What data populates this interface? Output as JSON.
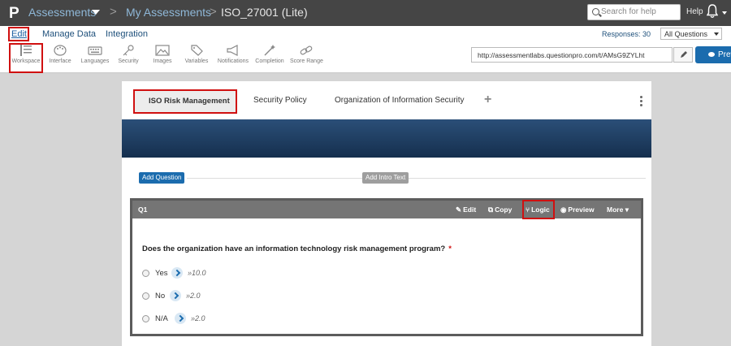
{
  "topbar": {
    "logo": "P",
    "breadcrumbs": [
      "Assessments",
      "My Assessments",
      "ISO_27001 (Lite)"
    ],
    "separator": ">",
    "search_placeholder": "Search for help",
    "help_label": "Help"
  },
  "menu": {
    "items": [
      "Edit",
      "Manage Data",
      "Integration"
    ],
    "responses_label": "Responses: 30",
    "filter_value": "All Questions"
  },
  "toolbar": {
    "tools": [
      {
        "label": "Workspace",
        "icon": "workspace-icon"
      },
      {
        "label": "Interface",
        "icon": "palette-icon"
      },
      {
        "label": "Languages",
        "icon": "keyboard-icon"
      },
      {
        "label": "Security",
        "icon": "key-icon"
      },
      {
        "label": "Images",
        "icon": "image-icon"
      },
      {
        "label": "Variables",
        "icon": "tag-icon"
      },
      {
        "label": "Notifications",
        "icon": "megaphone-icon"
      },
      {
        "label": "Completion",
        "icon": "magic-wand-icon"
      },
      {
        "label": "Score Range",
        "icon": "link-icon"
      }
    ],
    "url": "http://assessmentlabs.questionpro.com/t/AMsG9ZYLht",
    "preview_label": "Prev"
  },
  "tabs": {
    "items": [
      "ISO Risk Management",
      "Security Policy",
      "Organization of Information Security"
    ],
    "add_label": "+"
  },
  "actions": {
    "add_question": "Add Question",
    "add_intro": "Add Intro Text"
  },
  "question": {
    "number": "Q1",
    "actions": [
      "Edit",
      "Copy",
      "Logic",
      "Preview",
      "More"
    ],
    "text": "Does the organization have an information technology risk management program?",
    "required_mark": "*",
    "options": [
      {
        "label": "Yes",
        "score": "»10.0"
      },
      {
        "label": "No",
        "score": "»2.0"
      },
      {
        "label": "N/A",
        "score": "»2.0"
      }
    ]
  },
  "colors": {
    "topbar": "#454545",
    "accent": "#1b6cae",
    "highlight": "#d01010",
    "banner": "#1f3f63"
  }
}
